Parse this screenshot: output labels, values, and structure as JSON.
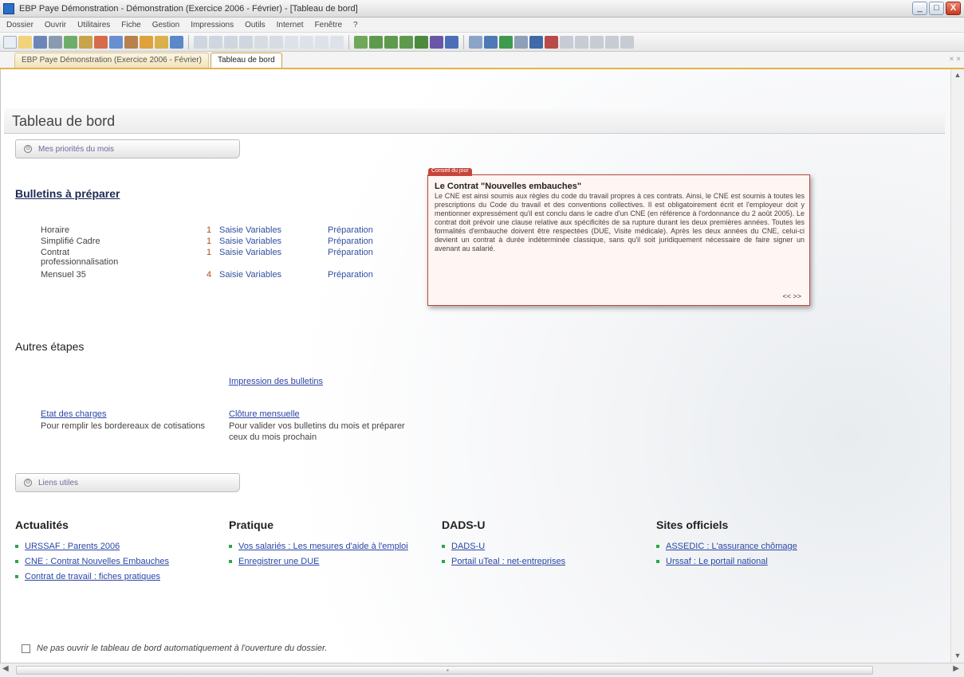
{
  "window": {
    "title": "EBP Paye Démonstration - Démonstration (Exercice 2006 - Février) - [Tableau de bord]",
    "controls": [
      "_",
      "□",
      "X"
    ]
  },
  "menu": [
    "Dossier",
    "Ouvrir",
    "Utilitaires",
    "Fiche",
    "Gestion",
    "Impressions",
    "Outils",
    "Internet",
    "Fenêtre",
    "?"
  ],
  "tabs": [
    {
      "label": "EBP Paye Démonstration (Exercice 2006 - Février)"
    },
    {
      "label": "Tableau de bord"
    }
  ],
  "page": {
    "title": "Tableau de bord"
  },
  "sections": {
    "priorities_label": "Mes priorités du mois",
    "useful_links_label": "Liens utiles"
  },
  "bulletins": {
    "heading": "Bulletins à préparer",
    "rows": [
      {
        "name": "Horaire",
        "count": "1",
        "link1": "Saisie Variables",
        "link2": "Préparation"
      },
      {
        "name": "Simplifié Cadre",
        "count": "1",
        "link1": "Saisie Variables",
        "link2": "Préparation"
      },
      {
        "name": "Contrat professionnalisation",
        "count": "1",
        "link1": "Saisie Variables",
        "link2": "Préparation"
      },
      {
        "name": "Mensuel 35",
        "count": "4",
        "link1": "Saisie Variables",
        "link2": "Préparation"
      }
    ]
  },
  "autres": {
    "heading": "Autres étapes",
    "impression_link": "Impression des bulletins",
    "etat_link": "Etat des charges",
    "etat_desc": "Pour remplir les bordereaux de cotisations",
    "cloture_link": "Clôture mensuelle",
    "cloture_desc": "Pour valider vos bulletins du mois et préparer ceux du mois prochain"
  },
  "tip": {
    "tab": "Conseil du jour",
    "title": "Le Contrat \"Nouvelles embauches\"",
    "body": "Le CNE est ainsi soumis aux règles du code du travail propres à ces contrats. Ainsi, le CNE est soumis à toutes les prescriptions du Code du travail et des conventions collectives. Il est obligatoirement écrit et l'employeur doit y mentionner expressément qu'il est conclu dans le cadre d'un CNE (en référence à l'ordonnance du 2 août 2005). Le contrat doit prévoir une clause relative aux spécificités de sa rupture durant les deux premières années. Toutes les formalités d'embauche doivent être respectées (DUE, Visite médicale). Après les deux années du CNE, celui-ci devient un contrat à durée indéterminée classique, sans qu'il soit juridiquement nécessaire de faire signer un avenant au salarié.",
    "nav": "<< >>"
  },
  "news": [
    {
      "heading": "Actualités",
      "items": [
        "URSSAF : Parents 2006",
        "CNE : Contrat Nouvelles Embauches",
        "Contrat de travail : fiches pratiques"
      ]
    },
    {
      "heading": "Pratique",
      "items": [
        "Vos salariés : Les mesures d'aide à l'emploi",
        "Enregistrer une DUE"
      ]
    },
    {
      "heading": "DADS-U",
      "items": [
        "DADS-U",
        "Portail uTeal : net-entreprises"
      ]
    },
    {
      "heading": "Sites officiels",
      "items": [
        "ASSEDIC : L'assurance chômage",
        "Urssaf : Le portail national"
      ]
    }
  ],
  "footer": {
    "checkbox_label": "Ne pas ouvrir le tableau de bord automatiquement à l'ouverture du dossier."
  },
  "colors": {
    "accent_tab": "#e6b24a",
    "tip_border": "#b64a3f",
    "link": "#2b46a6",
    "bullet": "#2fa54a"
  }
}
